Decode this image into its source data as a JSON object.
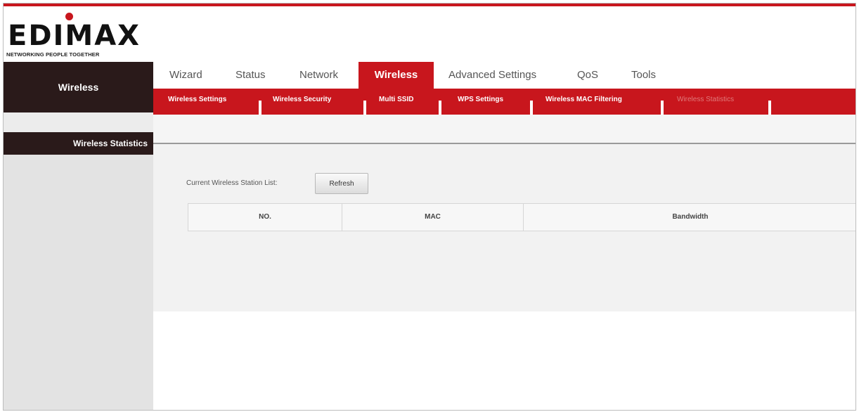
{
  "logo": {
    "word": "EDIMAX",
    "tagline": "NETWORKING PEOPLE TOGETHER"
  },
  "sidebar": {
    "section": "Wireless",
    "items": [
      {
        "label": "Wireless Statistics"
      }
    ]
  },
  "nav": {
    "tabs": [
      {
        "label": "Wizard"
      },
      {
        "label": "Status"
      },
      {
        "label": "Network"
      },
      {
        "label": "Wireless",
        "active": true
      },
      {
        "label": "Advanced Settings"
      },
      {
        "label": "QoS"
      },
      {
        "label": "Tools"
      }
    ]
  },
  "subnav": {
    "items": [
      {
        "label": "Wireless Settings"
      },
      {
        "label": "Wireless Security"
      },
      {
        "label": "Multi SSID"
      },
      {
        "label": "WPS Settings"
      },
      {
        "label": "Wireless MAC Filtering"
      },
      {
        "label": "Wireless Statistics",
        "current": true
      }
    ]
  },
  "main": {
    "station_list_label": "Current Wireless Station List:",
    "refresh_label": "Refresh",
    "table": {
      "columns": [
        "NO.",
        "MAC",
        "Bandwidth"
      ],
      "rows": []
    }
  },
  "colors": {
    "accent": "#c8161d",
    "sidebar_dark": "#2a1a1a",
    "sidebar_bg": "#e3e3e3",
    "content_bg": "#f2f2f2"
  }
}
